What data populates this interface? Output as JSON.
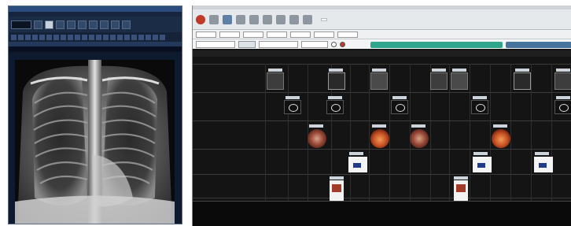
{
  "viewer": {
    "title": "",
    "menu": [
      "",
      "",
      "",
      "",
      ""
    ],
    "tab_label": "",
    "image": "chest-xray"
  },
  "timeline": {
    "title": "",
    "status": "",
    "search_value": "",
    "columns": [
      "",
      "",
      "",
      "",
      "",
      "",
      "",
      "",
      "",
      "",
      "",
      "",
      "",
      "",
      "",
      ""
    ],
    "green_bar_label": "",
    "accent_green": "#2fa58b",
    "accent_blue": "#47749c"
  }
}
